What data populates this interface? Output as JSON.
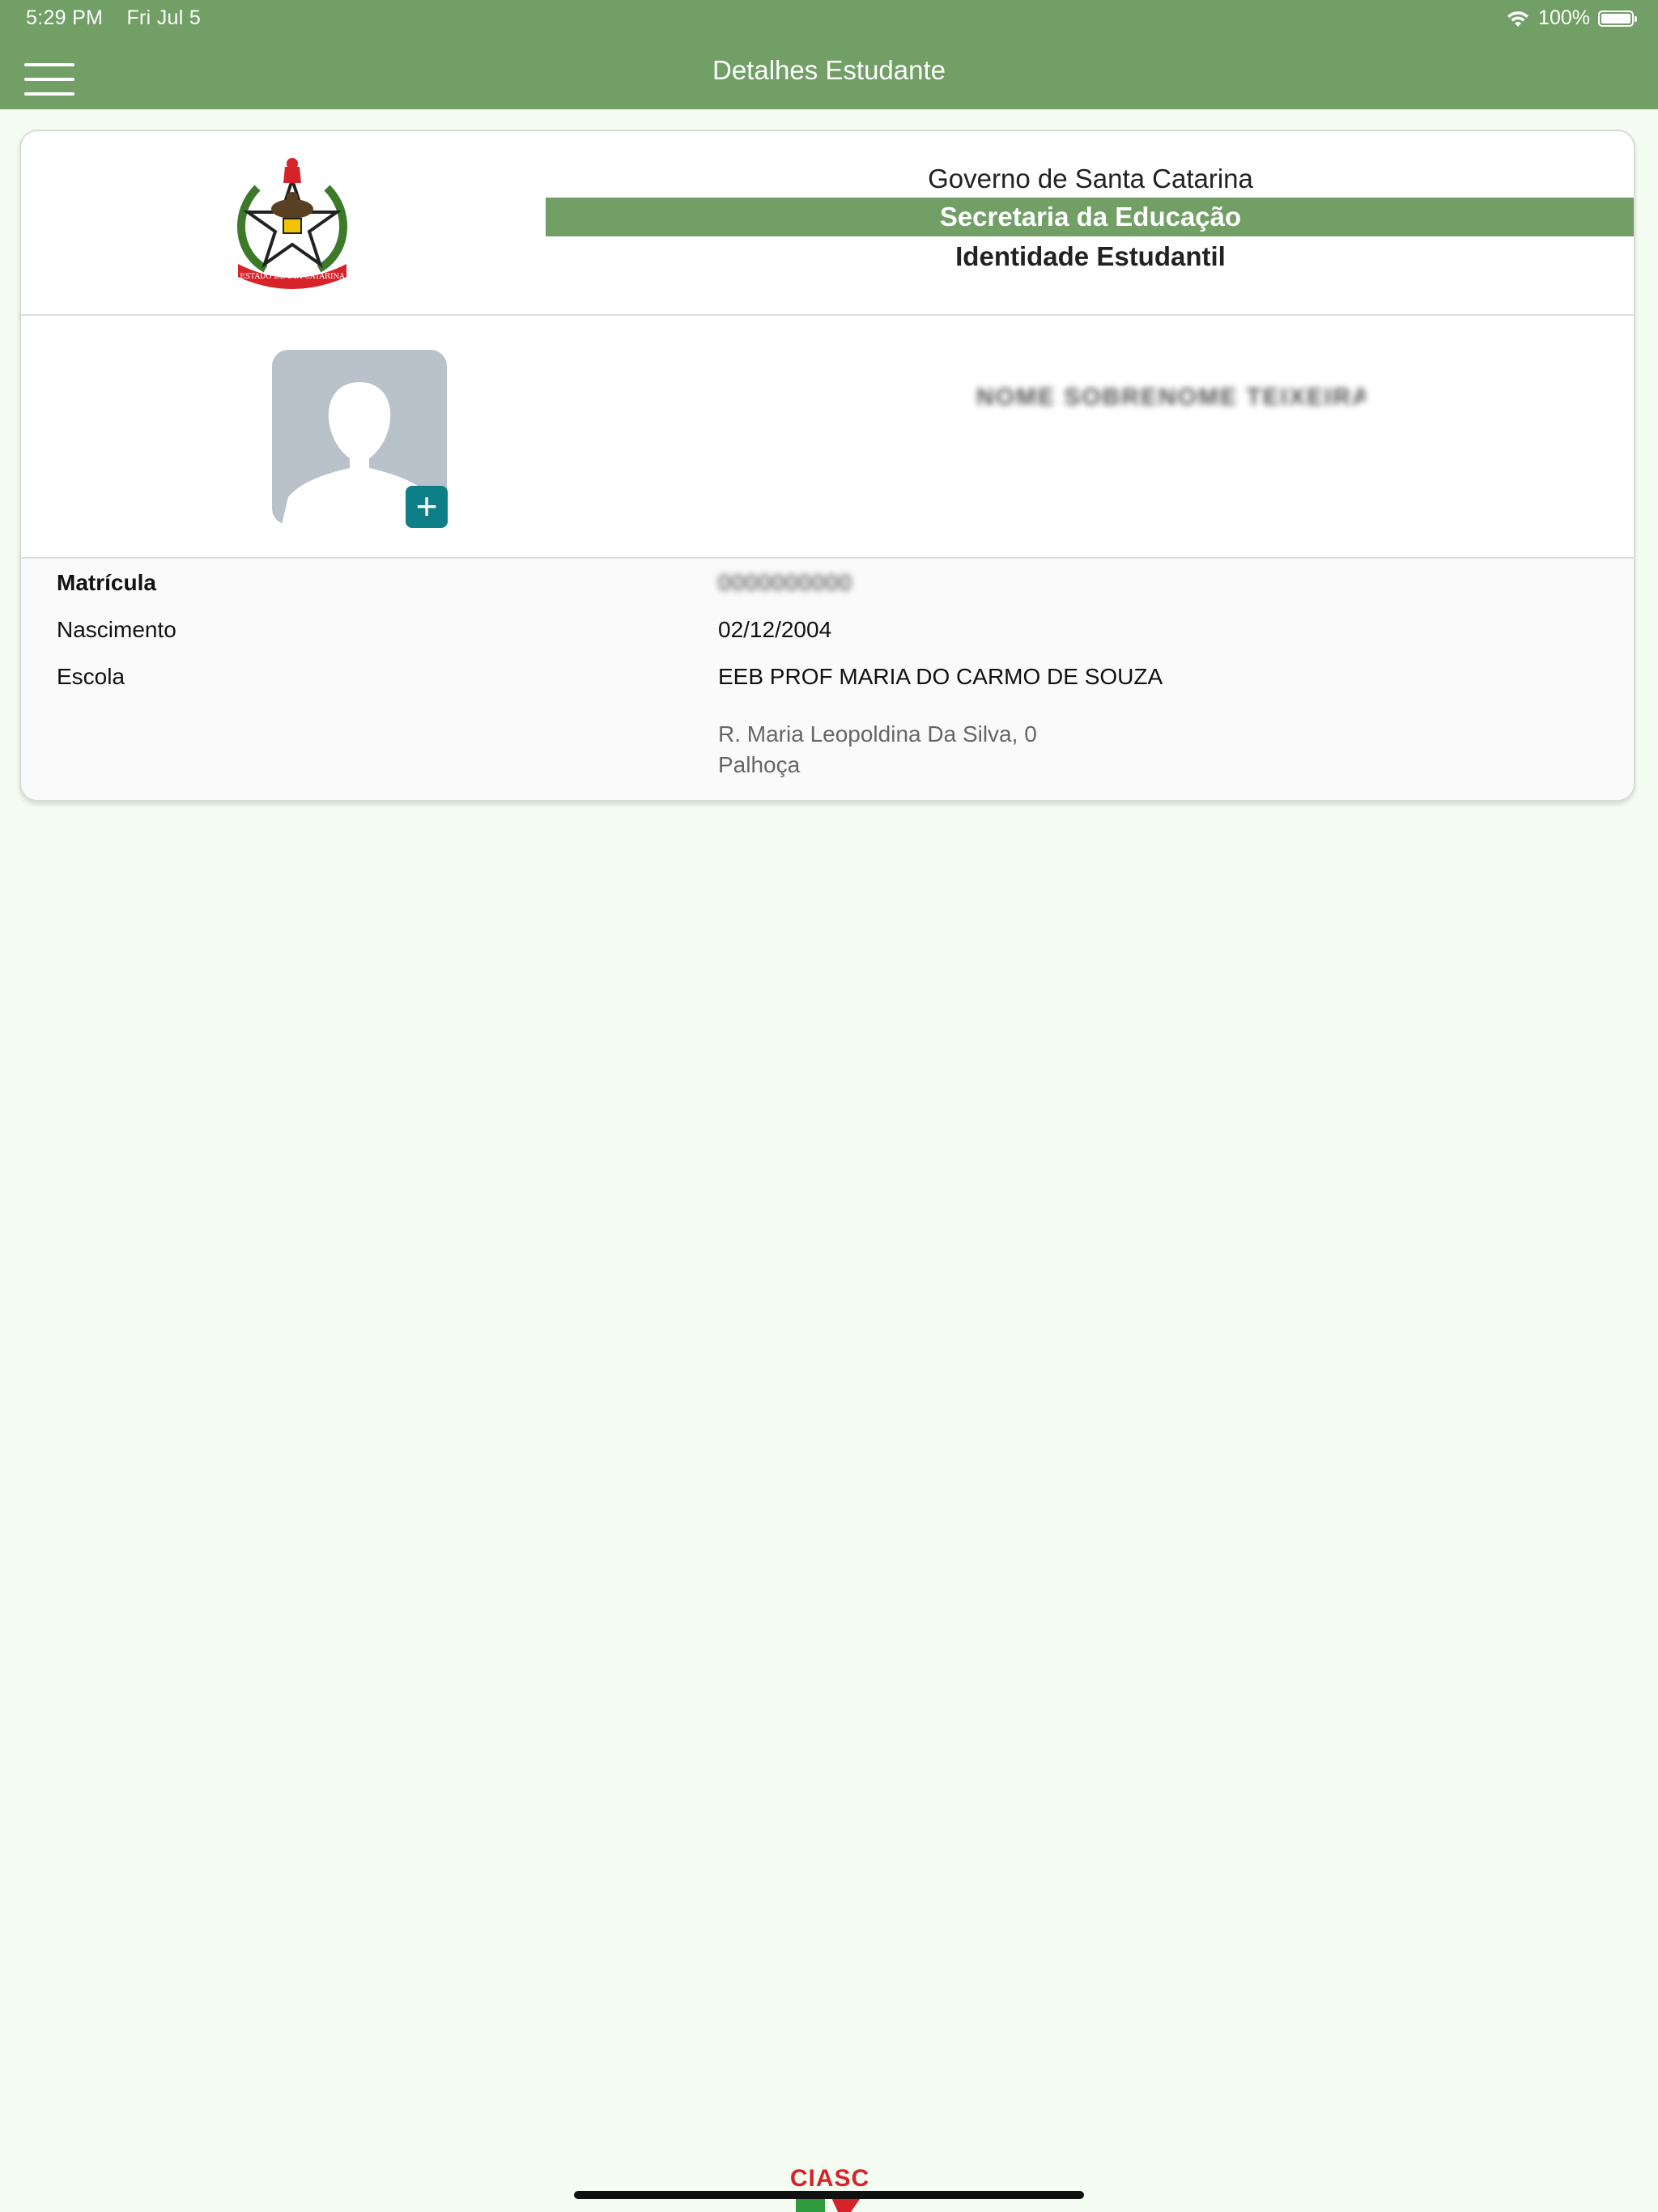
{
  "status_bar": {
    "time": "5:29 PM",
    "date": "Fri Jul 5",
    "battery": "100%",
    "battery_level": 100,
    "icons": [
      "wifi-icon",
      "battery-icon"
    ]
  },
  "nav": {
    "title": "Detalhes Estudante",
    "menu_icon": "hamburger-menu-icon"
  },
  "card": {
    "header": {
      "line1": "Governo de Santa Catarina",
      "line2": "Secretaria da Educação",
      "line3": "Identidade Estudantil",
      "crest": "state-coat-of-arms",
      "crest_text": "ESTADO DE STA CATARINA"
    },
    "student": {
      "name": "NOME SOBRENOME TEIXEIRA",
      "photo_placeholder": "person-silhouette-icon",
      "add_photo_label": "+"
    },
    "details": {
      "matricula_label": "Matrícula",
      "matricula_value": "0000000000",
      "nascimento_label": "Nascimento",
      "nascimento_value": "02/12/2004",
      "escola_label": "Escola",
      "escola_value": "EEB PROF MARIA DO CARMO DE SOUZA",
      "address_line1": "R. Maria Leopoldina Da Silva, 0",
      "address_line2": "Palhoça"
    }
  },
  "footer": {
    "logo_text": "CIASC"
  },
  "colors": {
    "primary": "#719f66",
    "background": "#f5fdf2",
    "add_button": "#0e7f87",
    "avatar_bg": "#b9c2ca"
  }
}
